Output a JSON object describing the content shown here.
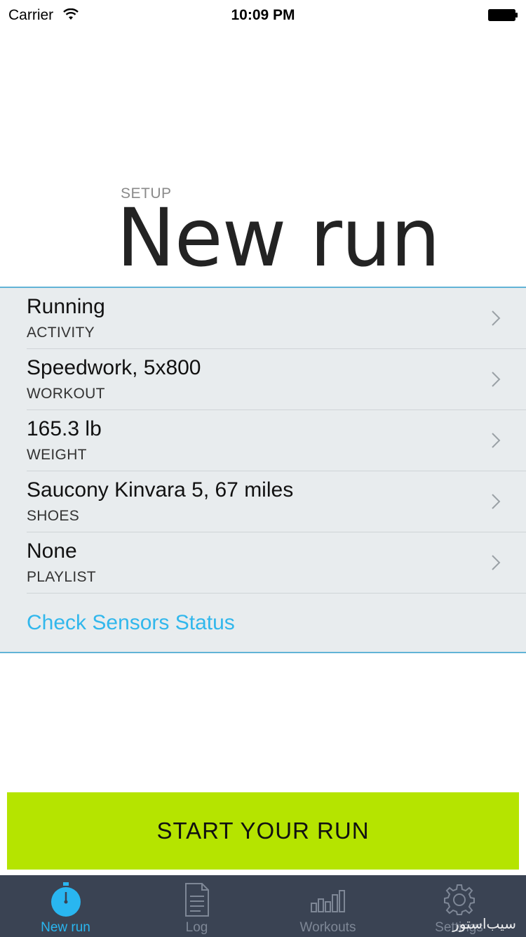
{
  "status_bar": {
    "carrier": "Carrier",
    "time": "10:09 PM",
    "wifi_icon": "wifi-icon",
    "battery_icon": "battery-icon"
  },
  "header": {
    "eyebrow": "SETUP",
    "title": "New run"
  },
  "settings": {
    "rows": [
      {
        "value": "Running",
        "label": "ACTIVITY"
      },
      {
        "value": "Speedwork, 5x800",
        "label": "WORKOUT"
      },
      {
        "value": "165.3 lb",
        "label": "WEIGHT"
      },
      {
        "value": "Saucony Kinvara 5, 67 miles",
        "label": "SHOES"
      },
      {
        "value": "None",
        "label": "PLAYLIST"
      }
    ],
    "sensors_link": "Check Sensors Status"
  },
  "start_button": {
    "label": "START YOUR RUN"
  },
  "tab_bar": {
    "tabs": [
      {
        "label": "New run",
        "icon": "stopwatch-icon",
        "active": true
      },
      {
        "label": "Log",
        "icon": "document-icon",
        "active": false
      },
      {
        "label": "Workouts",
        "icon": "bar-chart-icon",
        "active": false
      },
      {
        "label": "Settings",
        "icon": "gear-icon",
        "active": false
      }
    ]
  },
  "watermark": "سیب‌استور",
  "colors": {
    "accent": "#31b7ec",
    "start_button": "#b5e400",
    "tab_bar": "#3a4353",
    "panel": "#e8ecee",
    "panel_border": "#62b3d6"
  }
}
